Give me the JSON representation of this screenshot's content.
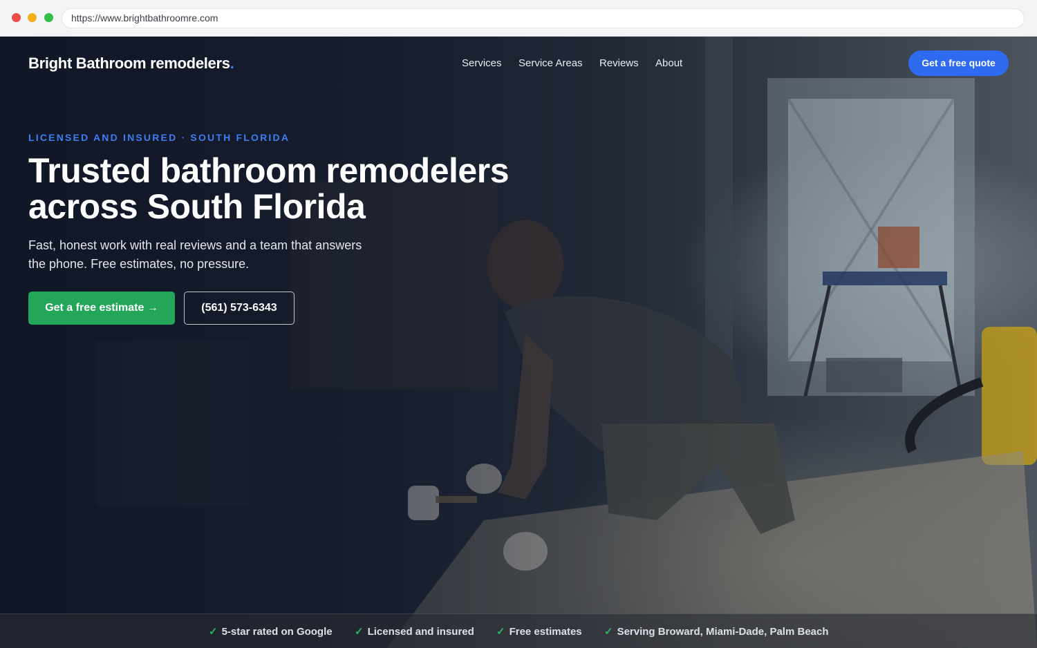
{
  "browser": {
    "url": "https://www.brightbathroomre.com"
  },
  "header": {
    "logo_text": "Bright Bathroom remodelers",
    "logo_dot": ".",
    "nav": {
      "services": "Services",
      "service_areas": "Service Areas",
      "reviews": "Reviews",
      "about": "About"
    },
    "cta_label": "Get a free quote"
  },
  "hero": {
    "eyebrow": "LICENSED AND INSURED · SOUTH FLORIDA",
    "headline_line1": "Trusted bathroom remodelers",
    "headline_line2": "across South Florida",
    "subtext_line1": "Fast, honest work with real reviews and a team that answers",
    "subtext_line2": "the phone. Free estimates, no pressure.",
    "primary_cta": "Get a free estimate →",
    "phone_cta": "(561) 573-6343"
  },
  "trust_bar": {
    "check_glyph": "✓",
    "items": [
      "5-star rated on Google",
      "Licensed and insured",
      "Free estimates",
      "Serving Broward, Miami-Dade, Palm Beach"
    ]
  },
  "colors": {
    "brand_blue": "#2f6bf0",
    "eyebrow_blue": "#3e7ef5",
    "cta_green": "#23a55a",
    "check_green": "#2fb463"
  }
}
